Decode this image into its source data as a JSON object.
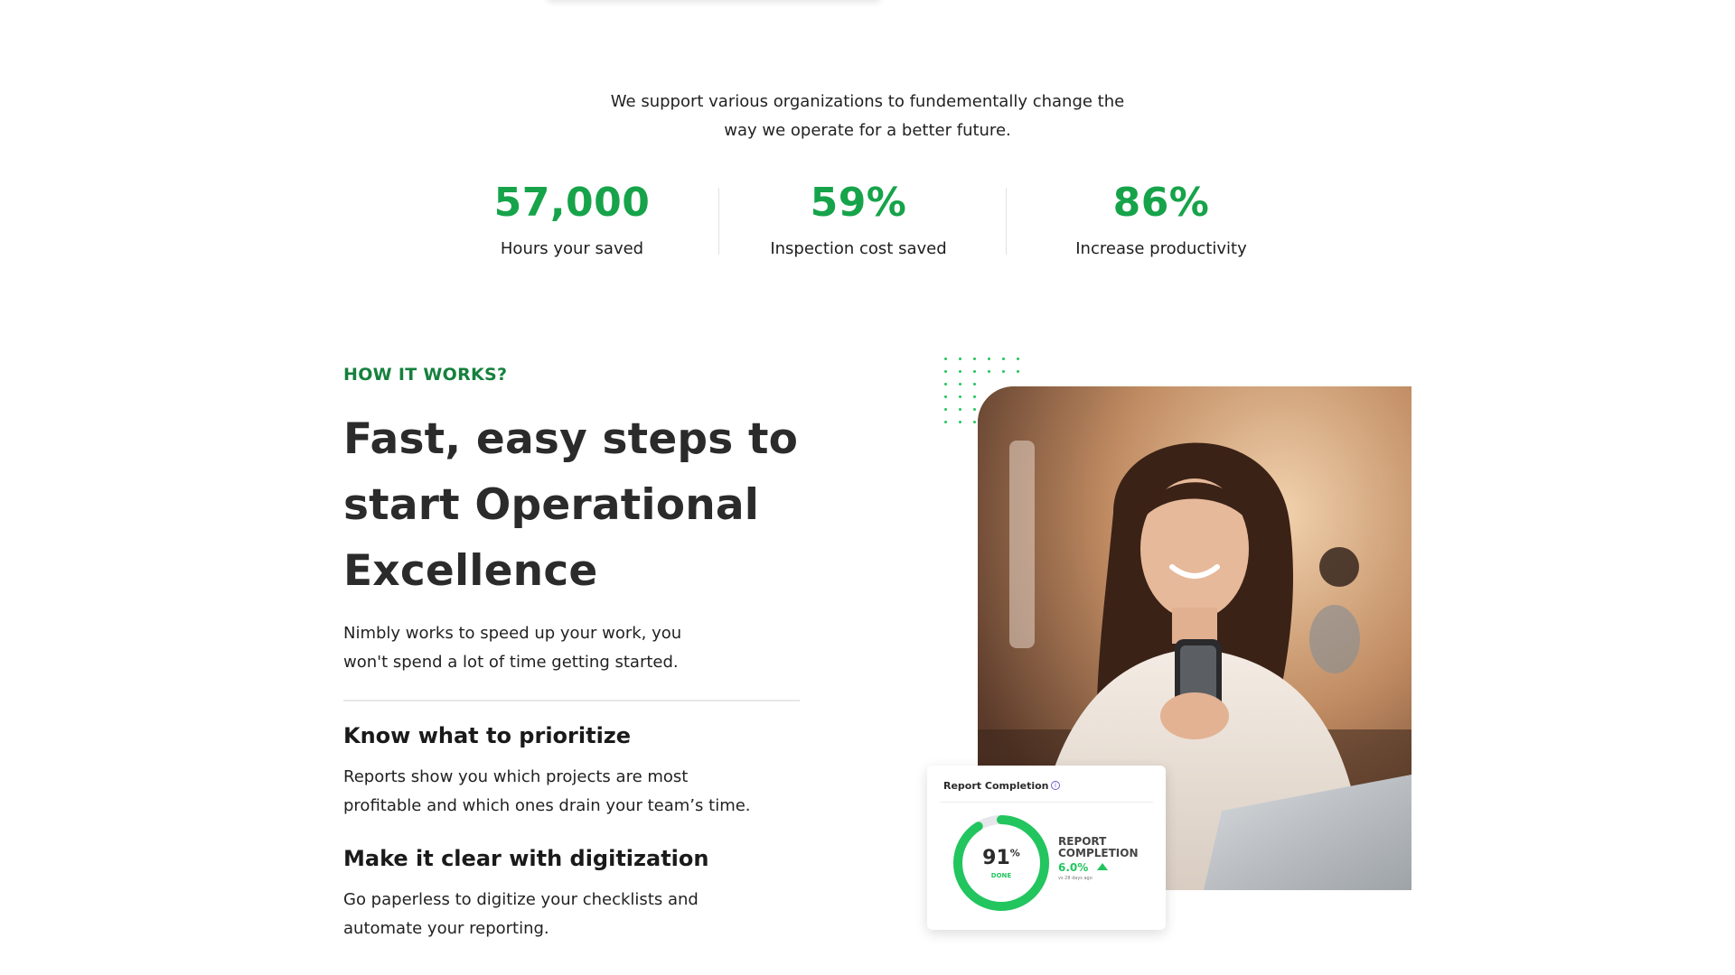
{
  "intro": {
    "line1": "We support various organizations to fundementally change the",
    "line2": "way we operate for a better future."
  },
  "stats": [
    {
      "value": "57,000",
      "label": "Hours your saved"
    },
    {
      "value": "59%",
      "label": "Inspection cost saved"
    },
    {
      "value": "86%",
      "label": "Increase productivity"
    }
  ],
  "how_it_works": {
    "eyebrow": "HOW IT WORKS?",
    "headline_lines": [
      "Fast, easy steps to",
      "start Operational",
      "Excellence"
    ],
    "lead_lines": [
      "Nimbly works to speed up your work, you",
      "won't spend a lot of time getting started."
    ],
    "features": [
      {
        "title": "Know what to prioritize",
        "desc_lines": [
          "Reports show you which projects are most",
          "profitable and which ones drain your team’s time."
        ]
      },
      {
        "title": "Make it clear with digitization",
        "desc_lines": [
          "Go paperless to digitize your checklists and",
          "automate your reporting."
        ]
      }
    ]
  },
  "report_card": {
    "title": "Report Completion",
    "info_glyph": "i",
    "percent": 91,
    "percent_number": "91",
    "percent_sign": "%",
    "done_label": "DONE",
    "label_lines": [
      "REPORT",
      "COMPLETION"
    ],
    "change": "6.0%",
    "change_sub": "vs 28 days ago"
  },
  "icons": {
    "info": "info-icon",
    "trend": "arrow-up-icon"
  },
  "colors": {
    "accent_green": "#16a34a",
    "eyebrow_green": "#15803d",
    "ring_green": "#22c55e",
    "ring_track": "#e5e7eb",
    "text_dark": "#2b2b2b"
  }
}
